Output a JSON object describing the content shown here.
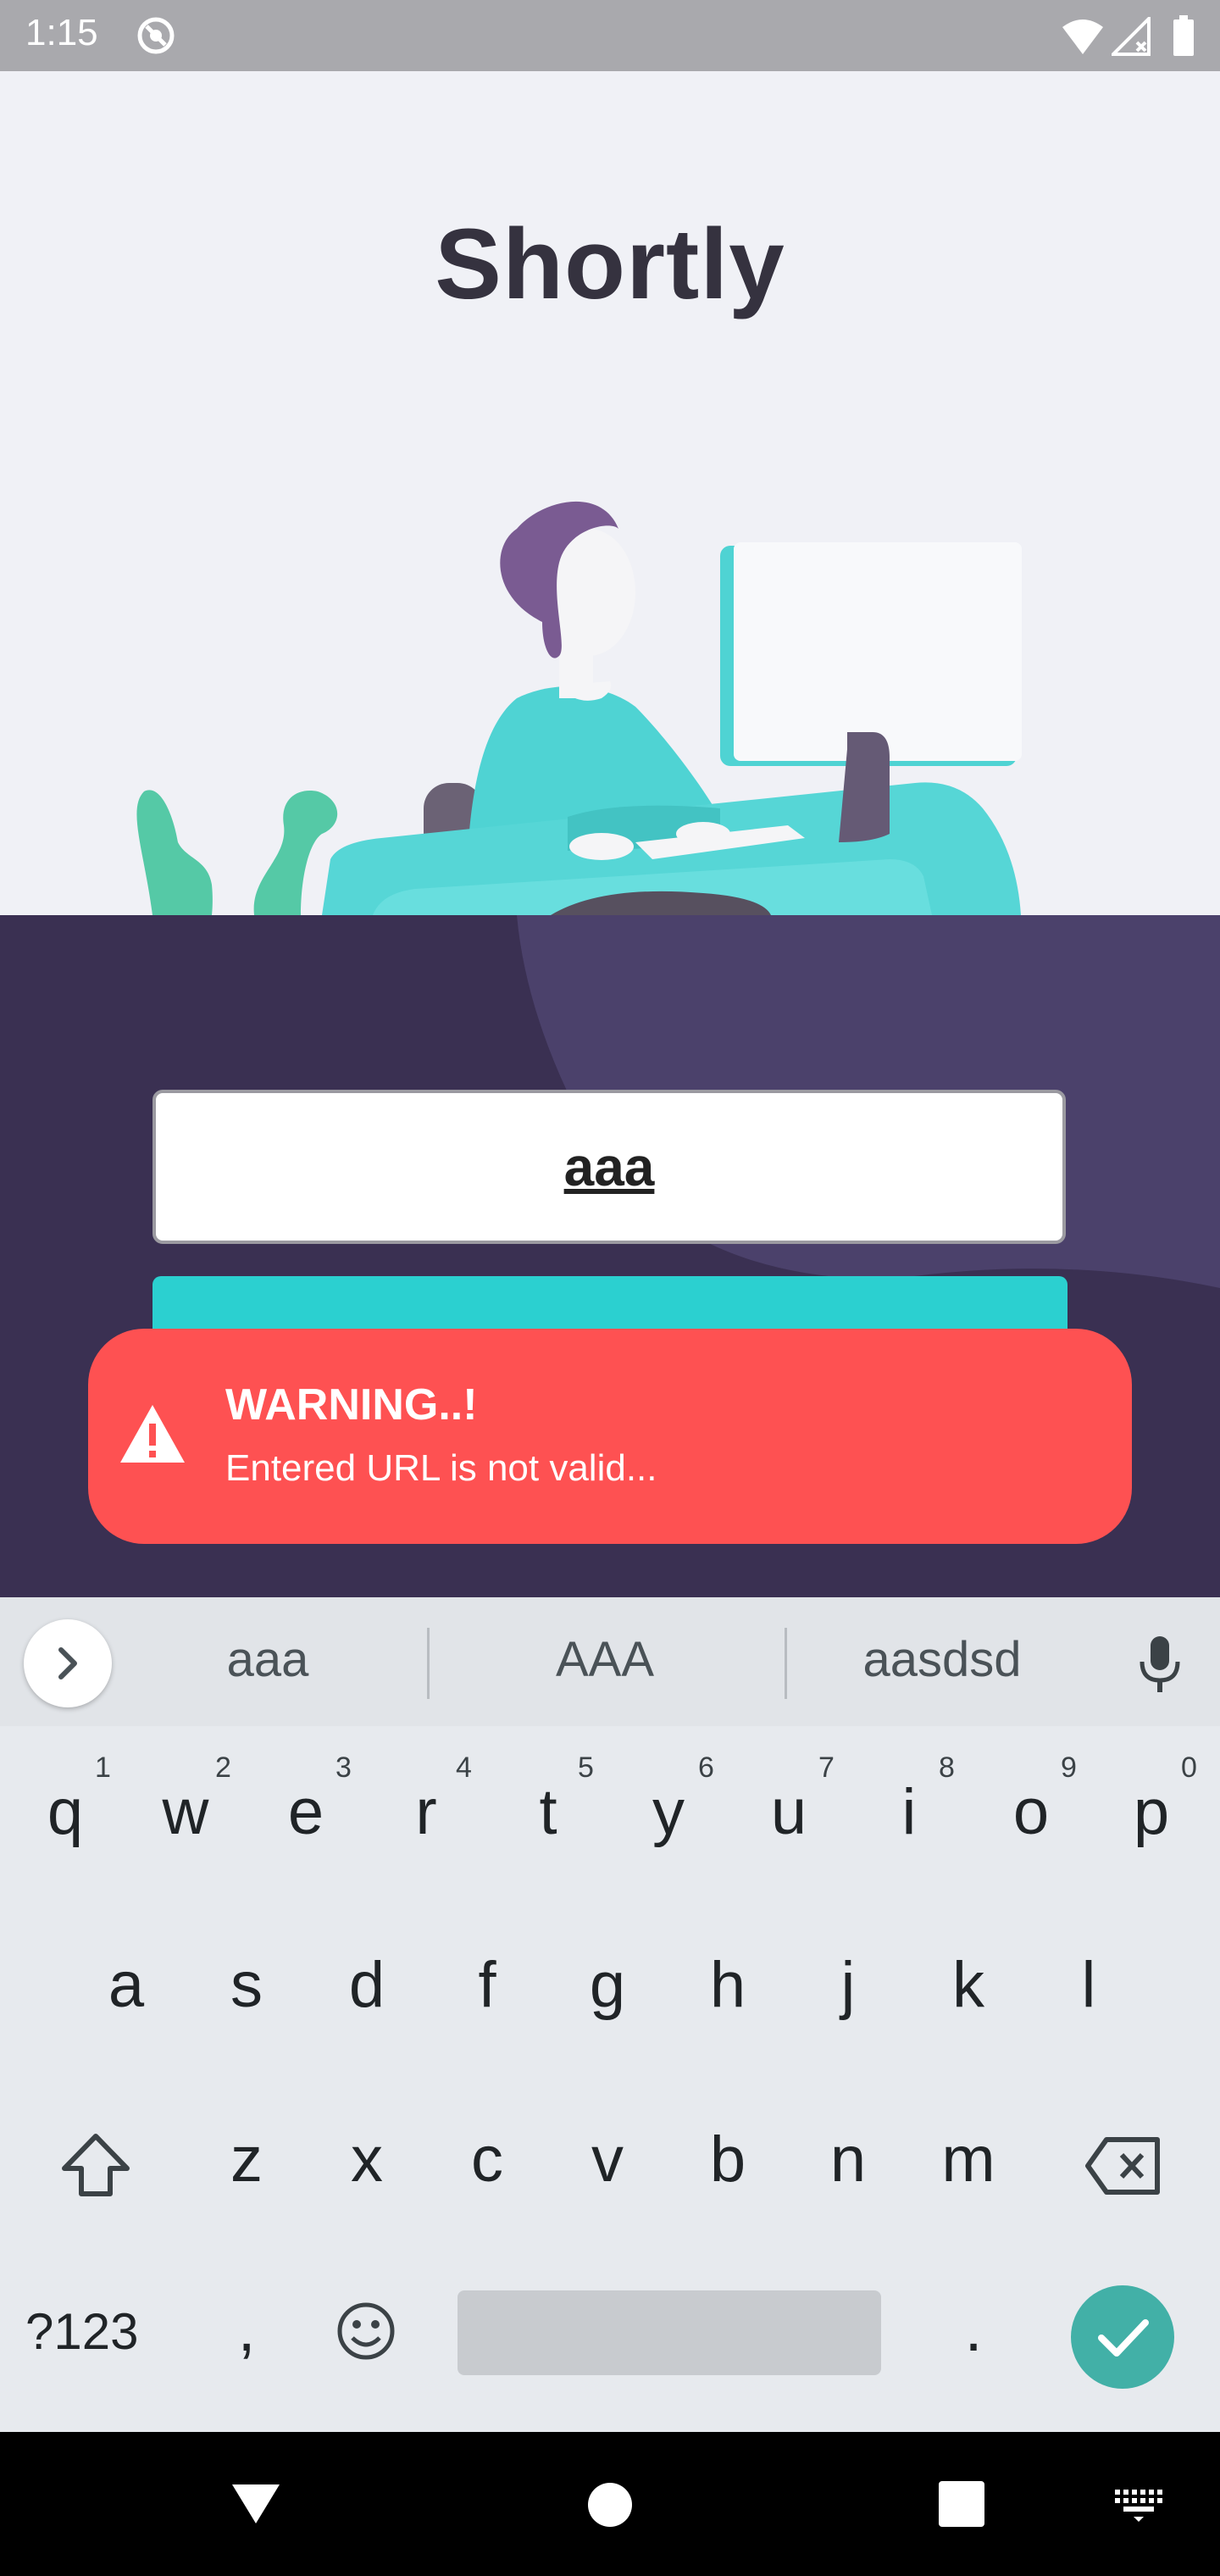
{
  "status_bar": {
    "time": "1:15"
  },
  "app": {
    "title": "Shortly"
  },
  "url_input": {
    "value": "aaa"
  },
  "toast": {
    "title": "WARNING..!",
    "message": "Entered URL is not valid..."
  },
  "keyboard": {
    "suggestions": [
      "aaa",
      "AAA",
      "aasdsd"
    ],
    "row1": [
      {
        "key": "q",
        "hint": "1"
      },
      {
        "key": "w",
        "hint": "2"
      },
      {
        "key": "e",
        "hint": "3"
      },
      {
        "key": "r",
        "hint": "4"
      },
      {
        "key": "t",
        "hint": "5"
      },
      {
        "key": "y",
        "hint": "6"
      },
      {
        "key": "u",
        "hint": "7"
      },
      {
        "key": "i",
        "hint": "8"
      },
      {
        "key": "o",
        "hint": "9"
      },
      {
        "key": "p",
        "hint": "0"
      }
    ],
    "row2": [
      "a",
      "s",
      "d",
      "f",
      "g",
      "h",
      "j",
      "k",
      "l"
    ],
    "row3": [
      "z",
      "x",
      "c",
      "v",
      "b",
      "n",
      "m"
    ],
    "symbols_label": "?123",
    "comma": ",",
    "period": "."
  },
  "colors": {
    "purple_bg": "#3a3052",
    "teal_button": "#2bd0d0",
    "toast_red": "#fe5152",
    "enter_key": "#42b0a7"
  }
}
